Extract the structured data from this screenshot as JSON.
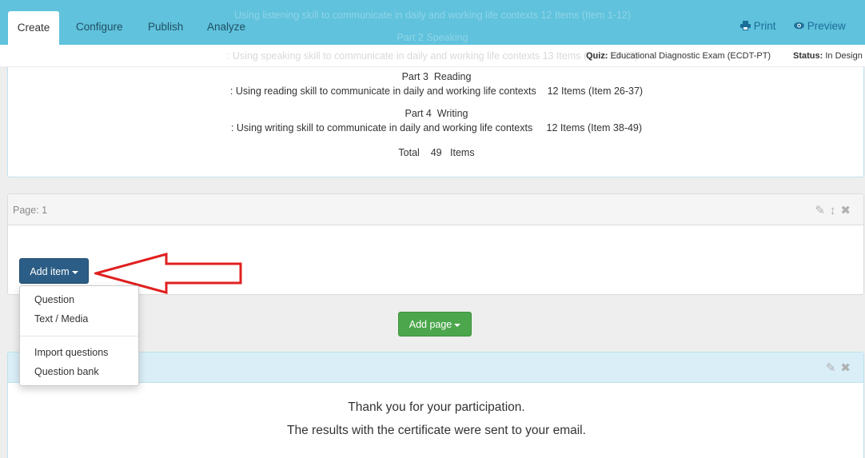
{
  "nav": {
    "tabs": [
      {
        "label": "Create"
      },
      {
        "label": "Configure"
      },
      {
        "label": "Publish"
      },
      {
        "label": "Analyze"
      }
    ],
    "print_label": "Print",
    "preview_label": "Preview",
    "ghost_line1": "Using listening skill to communicate in daily and working life contexts   12 Items (Item 1-12)",
    "ghost_line2": "Part 2  Speaking"
  },
  "infobar": {
    "ghost_text": ": Using speaking skill to communicate in daily and working life contexts   13 Items (Item 13-25)",
    "quiz_label": "Quiz:",
    "quiz_value": "Educational Diagnostic Exam (ECDT-PT)",
    "status_label": "Status:",
    "status_value": "In Design"
  },
  "intro": {
    "part3_title": "Part 3  Reading",
    "part3_desc": ": Using reading skill to communicate in daily and working life contexts    12 Items (Item 26-37)",
    "part4_title": "Part 4  Writing",
    "part4_desc": ": Using writing skill to communicate in daily and working life contexts     12 Items (Item 38-49)",
    "total": "Total    49   Items"
  },
  "page_panel": {
    "label": "Page: 1",
    "add_item_label": "Add item"
  },
  "add_page_label": "Add page",
  "dropdown": {
    "items": [
      {
        "label": "Question"
      },
      {
        "label": "Text / Media"
      },
      {
        "label": "Import questions"
      },
      {
        "label": "Question bank"
      }
    ]
  },
  "thanks": {
    "line1": "Thank you for your participation.",
    "line2": "The results with the certificate were sent to your email."
  },
  "colors": {
    "nav_bg": "#60c2dc",
    "primary_button": "#2b5d86",
    "success_button": "#4ca74c",
    "annotation_arrow": "#e02020"
  }
}
